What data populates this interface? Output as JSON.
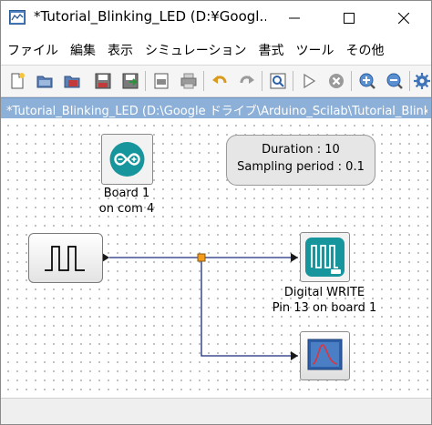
{
  "window": {
    "title": "*Tutorial_Blinking_LED (D:¥Googl..."
  },
  "menu": [
    "ファイル",
    "編集",
    "表示",
    "シミュレーション",
    "書式",
    "ツール",
    "その他"
  ],
  "toolbar": {
    "icons": [
      "new-diagram-icon",
      "open-icon",
      "open-in-scilab-icon",
      "save-icon",
      "save-as-icon",
      "export-icon",
      "print-icon",
      "undo-icon",
      "redo-icon",
      "fit-diagram-icon",
      "start-icon",
      "stop-icon",
      "zoom-in-icon",
      "zoom-out-icon",
      "settings-icon"
    ]
  },
  "pathbar": {
    "text": "*Tutorial_Blinking_LED (D:\\Google ドライブ\\Arduino_Scilab\\Tutorial_Blinking"
  },
  "diagram": {
    "params": {
      "duration": "Duration : 10",
      "sampling": "Sampling period : 0.1"
    },
    "board": {
      "line1": "Board 1",
      "line2": "on com 4"
    },
    "digital_write": {
      "line1": "Digital WRITE",
      "line2": "Pin 13 on board 1"
    },
    "colors": {
      "arduino_teal": "#17959c",
      "link": "#1c2a7a",
      "split": "#f39b1a"
    }
  }
}
